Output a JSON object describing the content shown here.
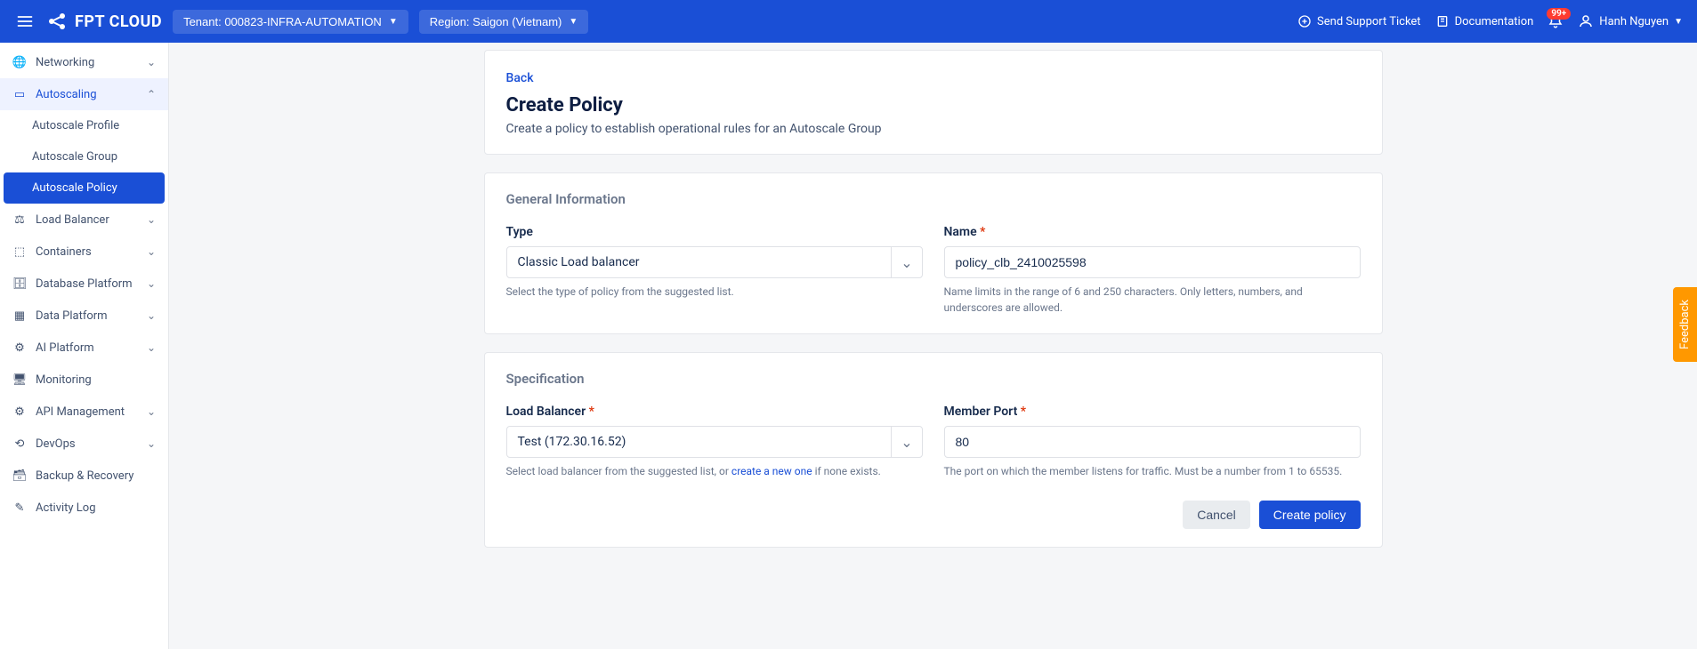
{
  "header": {
    "brand": "FPT CLOUD",
    "tenant_label": "Tenant: 000823-INFRA-AUTOMATION",
    "region_label": "Region: Saigon (Vietnam)",
    "support_label": "Send Support Ticket",
    "docs_label": "Documentation",
    "notifications_badge": "99+",
    "user_name": "Hanh Nguyen"
  },
  "sidebar": {
    "networking": "Networking",
    "autoscaling": "Autoscaling",
    "autoscale_profile": "Autoscale Profile",
    "autoscale_group": "Autoscale Group",
    "autoscale_policy": "Autoscale Policy",
    "load_balancer": "Load Balancer",
    "containers": "Containers",
    "database_platform": "Database Platform",
    "data_platform": "Data Platform",
    "ai_platform": "AI Platform",
    "monitoring": "Monitoring",
    "api_management": "API Management",
    "devops": "DevOps",
    "backup_recovery": "Backup & Recovery",
    "activity_log": "Activity Log"
  },
  "page": {
    "back": "Back",
    "title": "Create Policy",
    "description": "Create a policy to establish operational rules for an Autoscale Group"
  },
  "general": {
    "section_title": "General Information",
    "type_label": "Type",
    "type_value": "Classic Load balancer",
    "type_help": "Select the type of policy from the suggested list.",
    "name_label": "Name",
    "name_value": "policy_clb_2410025598",
    "name_help": "Name limits in the range of 6 and 250 characters. Only letters, numbers, and underscores are allowed."
  },
  "spec": {
    "section_title": "Specification",
    "lb_label": "Load Balancer",
    "lb_value": "Test (172.30.16.52)",
    "lb_help_pre": "Select load balancer from the suggested list, or ",
    "lb_help_link": "create a new one",
    "lb_help_post": " if none exists.",
    "port_label": "Member Port",
    "port_value": "80",
    "port_help": "The port on which the member listens for traffic. Must be a number from 1 to 65535."
  },
  "actions": {
    "cancel": "Cancel",
    "create": "Create policy"
  },
  "feedback": "Feedback"
}
